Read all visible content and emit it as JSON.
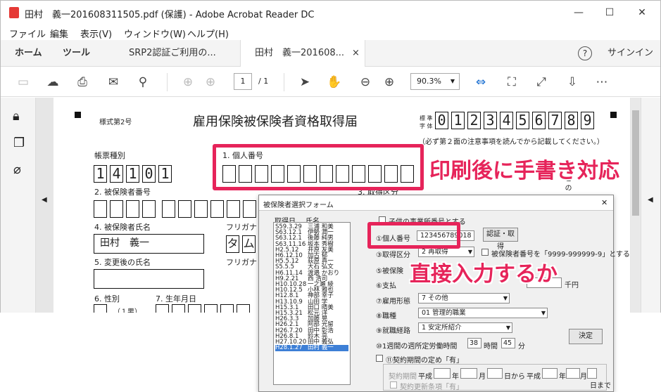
{
  "window": {
    "title": "田村　義一201608311505.pdf (保護) - Adobe Acrobat Reader DC",
    "minimize": "—",
    "maximize": "☐",
    "close": "✕"
  },
  "menu": [
    "ファイル",
    "編集",
    "表示(V)",
    "ウィンドウ(W)",
    "ヘルプ(H)"
  ],
  "tabs": {
    "home": "ホーム",
    "tools": "ツール",
    "doc1": "SRP2認証ご利用の...",
    "doc2": "田村　義一201608...",
    "doc2_close": "×",
    "help": "?",
    "signin": "サインイン"
  },
  "toolbar": {
    "page_current": "1",
    "page_total": "/ 1",
    "zoom": "90.3%"
  },
  "form": {
    "form_no": "様式第2号",
    "title": "雇用保険被保険者資格取得届",
    "std_label1": "標 準",
    "std_label2": "字 体",
    "std_digits": [
      "0",
      "1",
      "2",
      "3",
      "4",
      "5",
      "6",
      "7",
      "8",
      "9"
    ],
    "note": "（必ず第２面の注意事項を読んでから記載してください。）",
    "form_type_label": "帳票種別",
    "form_type_digits": [
      "1",
      "4",
      "1",
      "0",
      "1"
    ],
    "mynumber_label": "1. 個人番号",
    "insured_no_label": "2. 被保険者番号",
    "acquire_label": "3. 取得区分",
    "name_label": "4. 被保険者氏名",
    "furigana_label": "フリガナ",
    "name_value": "田村　義一",
    "kana1": "タ",
    "kana2": "ム",
    "changed_name_label": "5. 変更後の氏名",
    "furigana_label2": "フリガナ",
    "sex_label": "6. 性別",
    "sex_hint": "（１男）",
    "birth_label": "7. 生年月日",
    "side_text": "こ の"
  },
  "callouts": {
    "handwrite": "印刷後に手書き対応",
    "direct": "直接入力するか"
  },
  "dialog": {
    "title": "被保険者選択フォーム",
    "close": "✕",
    "col_date": "取得日",
    "col_name": "氏名",
    "rows": [
      [
        "S59.3.29",
        "三浦 和美"
      ],
      [
        "S63.12.1",
        "伊勢 潤一"
      ],
      [
        "S63.12.1",
        "後藤 純男"
      ],
      [
        "S63.11.16",
        "坂本 秀樹"
      ],
      [
        "H2.5.12",
        "井原 友美"
      ],
      [
        "H6.12.10",
        "加古 郁"
      ],
      [
        "H5.5.12",
        "荻原 真一"
      ],
      [
        "S5.5.5",
        "大石 弘文"
      ],
      [
        "H6.11.14",
        "渡邉 かおり"
      ],
      [
        "H9.2.21",
        "西 浩司"
      ],
      [
        "H10.10.28",
        "一之瀬 綾"
      ],
      [
        "H10.12.5",
        "小林 雅也"
      ],
      [
        "H12.8.1",
        "神部 幸子"
      ],
      [
        "H13.10.9",
        "山田 学"
      ],
      [
        "H15.3.1",
        "田口 晴美"
      ],
      [
        "H15.3.21",
        "松元 洋"
      ],
      [
        "H26.3.3",
        "加藤 晃"
      ],
      [
        "H26.2.1",
        "阿部 光留"
      ],
      [
        "H26.7.20",
        "田中 彰浩"
      ],
      [
        "H26.8.1",
        "鈴木 亮"
      ],
      [
        "H27.10.20",
        "田中 義弘"
      ],
      [
        "H28.1.27",
        "田村 義一"
      ]
    ],
    "selected_index": 21,
    "top_check": "子供の事業所番号とする",
    "mynumber_label": "①個人番号",
    "mynumber_value": "123456789018",
    "auth_button": "認証・取得",
    "acquire_label": "③取得区分",
    "acquire_value": "2 再取得",
    "insured_check": "被保険者番号を「9999-999999-9」とする",
    "cause_label": "⑤被保険",
    "wage_label": "⑥支払",
    "yen": "千円",
    "employ_label": "⑦雇用形態",
    "employ_value": "7 その他",
    "job_label": "⑧職種",
    "job_value": "01 管理的職業",
    "route_label": "⑨就職経路",
    "route_value": "1 安定所紹介",
    "hours_label": "⑩1週間の週所定労働時間",
    "hours_value": "38",
    "hours_unit": "時間",
    "min_value": "45",
    "min_unit": "分",
    "decide_button": "決定",
    "contract_check": "⑪契約期間の定め「有」",
    "contract_label": "契約期間",
    "heisei1": "平成",
    "nen1": "年",
    "tsuki1": "月",
    "hikara": "日から",
    "heisei2": "平成",
    "nen2": "年",
    "tsuki2": "月",
    "himade": "日まで",
    "renew_check": "契約更新条項「有」"
  },
  "colors": {
    "accent": "#e6245a",
    "selection": "#3d7fd6"
  }
}
